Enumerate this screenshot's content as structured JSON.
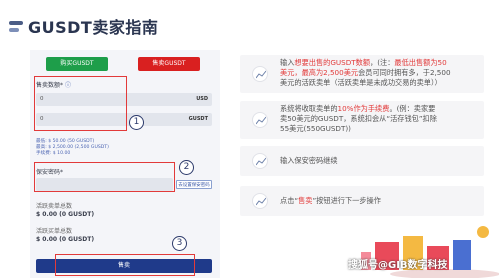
{
  "header": {
    "title": "GUSDT卖家指南"
  },
  "form": {
    "buy_button": "购买GUSDT",
    "sell_button": "售卖GUSDT",
    "sell_qty_label": "售卖数额*",
    "amount_value": "0",
    "amount_unit": "USD",
    "qty_value": "0",
    "qty_unit": "GUSDT",
    "stats": [
      "最低: $ 50.00 (50 GUSDT)",
      "最高: $ 2,500.00 (2,500 GUSDT)",
      "手续费: $ 10.00"
    ],
    "password_label": "保安密码*",
    "bind_button": "去设置保安密码",
    "active_sells_label": "活跃卖单总数",
    "active_sells_value": "$ 0.00 (0 GUSDT)",
    "pending_sells_label": "活跃买单总数",
    "pending_sells_value": "$ 0.00 (0 GUSDT)",
    "submit_button": "售卖",
    "markers": [
      "1",
      "2",
      "3"
    ]
  },
  "steps": [
    {
      "line1_a": "输入",
      "line1_red": "想要出售的GUSDT数额",
      "line1_b": "，(注：",
      "line1_red2": "最低出售额为50",
      "line2_red": "美元，最高为2,500美元",
      "line2_b": "会员可同时拥有多，于2,500",
      "line3": "美元的活跃卖单（活跃卖单是未成功交易的卖单））"
    },
    {
      "line1_a": "系统将收取卖单的",
      "line1_red": "10%作为手续费",
      "line1_b": "。(例：卖家要",
      "line2": "卖50美元的GUSDT，系统扣会从“活存钱包”扣除",
      "line3": "55美元(550GUSDT))"
    },
    {
      "text": "输入保安密码继续"
    },
    {
      "text_a": "点击“",
      "text_red": "售卖",
      "text_b": "”按钮进行下一步操作"
    }
  ],
  "watermark": "搜狐号@GIB数字科技"
}
